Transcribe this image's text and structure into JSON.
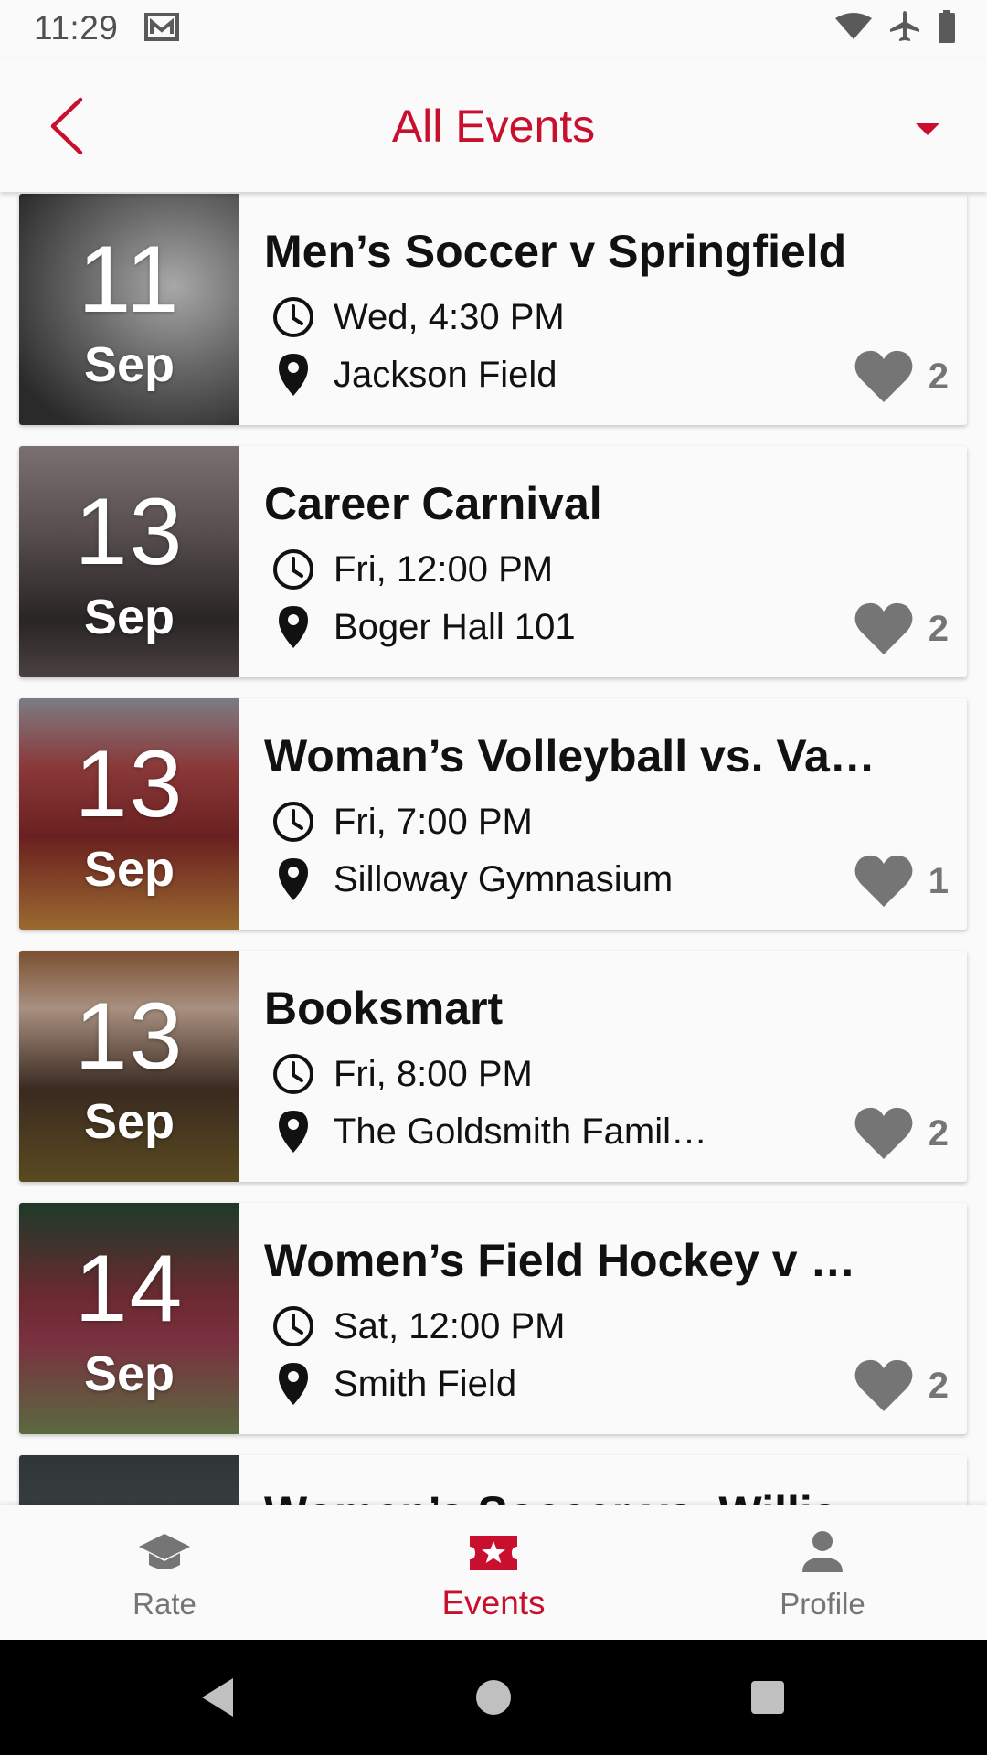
{
  "status_bar": {
    "time": "11:29",
    "icons": [
      "mail-icon",
      "wifi-icon",
      "airplane-icon",
      "battery-icon"
    ]
  },
  "app_bar": {
    "title": "All Events",
    "back_icon": "chevron-left-icon",
    "dropdown_icon": "caret-down-icon"
  },
  "colors": {
    "accent": "#c8102e",
    "inactive": "#757575",
    "heart": "#757575"
  },
  "events": [
    {
      "day": "11",
      "month": "Sep",
      "title": "Men’s Soccer v Springfield",
      "time": "Wed, 4:30 PM",
      "location": "Jackson Field",
      "likes": "2"
    },
    {
      "day": "13",
      "month": "Sep",
      "title": "Career Carnival",
      "time": "Fri, 12:00 PM",
      "location": "Boger Hall 101",
      "likes": "2"
    },
    {
      "day": "13",
      "month": "Sep",
      "title": "Woman’s Volleyball vs. Va…",
      "time": "Fri, 7:00 PM",
      "location": "Silloway Gymnasium",
      "likes": "1"
    },
    {
      "day": "13",
      "month": "Sep",
      "title": "Booksmart",
      "time": "Fri, 8:00 PM",
      "location": "The Goldsmith Famil…",
      "likes": "2"
    },
    {
      "day": "14",
      "month": "Sep",
      "title": "Women’s Field Hockey v …",
      "time": "Sat, 12:00 PM",
      "location": "Smith Field",
      "likes": "2"
    },
    {
      "day": "",
      "month": "",
      "title": "Women’s Soccer vs. Willia",
      "time": "",
      "location": "",
      "likes": ""
    }
  ],
  "bottom_nav": {
    "items": [
      {
        "label": "Rate",
        "icon": "graduation-cap-icon",
        "active": false
      },
      {
        "label": "Events",
        "icon": "ticket-star-icon",
        "active": true
      },
      {
        "label": "Profile",
        "icon": "person-icon",
        "active": false
      }
    ]
  },
  "system_nav": {
    "icons": [
      "back-triangle-icon",
      "home-circle-icon",
      "recents-square-icon"
    ]
  }
}
